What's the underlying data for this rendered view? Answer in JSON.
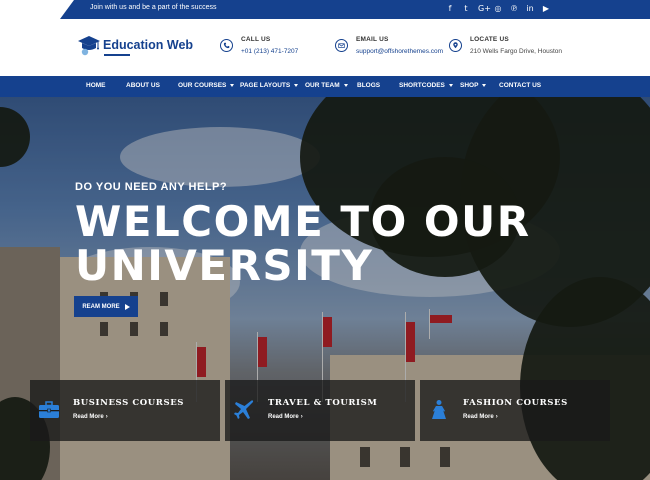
{
  "topbar": {
    "tagline": "Join with us and be a part of the success",
    "socials": [
      {
        "icon": "facebook-icon",
        "glyph": "f"
      },
      {
        "icon": "twitter-icon",
        "glyph": "t"
      },
      {
        "icon": "google-plus-icon",
        "glyph": "G+"
      },
      {
        "icon": "instagram-icon",
        "glyph": "◎"
      },
      {
        "icon": "pinterest-icon",
        "glyph": "℗"
      },
      {
        "icon": "linkedin-icon",
        "glyph": "in"
      },
      {
        "icon": "youtube-icon",
        "glyph": "▶"
      }
    ]
  },
  "header": {
    "logo_text": "Education Web",
    "contacts": [
      {
        "label": "CALL US",
        "value": "+01 (213) 471-7207",
        "icon": "phone-icon"
      },
      {
        "label": "EMAIL US",
        "value": "support@offshorethemes.com",
        "icon": "email-icon"
      },
      {
        "label": "LOCATE US",
        "value": "210 Wells Fargo Drive, Houston",
        "icon": "location-icon"
      }
    ]
  },
  "nav": {
    "items": [
      {
        "label": "HOME",
        "dropdown": false
      },
      {
        "label": "ABOUT US",
        "dropdown": false
      },
      {
        "label": "OUR COURSES",
        "dropdown": true
      },
      {
        "label": "PAGE LAYOUTS",
        "dropdown": true
      },
      {
        "label": "OUR TEAM",
        "dropdown": true
      },
      {
        "label": "BLOGS",
        "dropdown": false
      },
      {
        "label": "SHORTCODES",
        "dropdown": true
      },
      {
        "label": "SHOP",
        "dropdown": true
      },
      {
        "label": "CONTACT US",
        "dropdown": false
      }
    ]
  },
  "hero": {
    "subtitle": "DO YOU NEED ANY HELP?",
    "title_line1": "WELCOME TO OUR",
    "title_line2": "UNIVERSITY",
    "button_label": "REAM MORE"
  },
  "courses": [
    {
      "title": "BUSINESS COURSES",
      "link": "Read More",
      "icon": "briefcase-icon"
    },
    {
      "title": "TRAVEL & TOURISM",
      "link": "Read More",
      "icon": "airplane-icon"
    },
    {
      "title": "FASHION COURSES",
      "link": "Read More",
      "icon": "dress-icon"
    }
  ],
  "colors": {
    "brand": "#15418e"
  }
}
